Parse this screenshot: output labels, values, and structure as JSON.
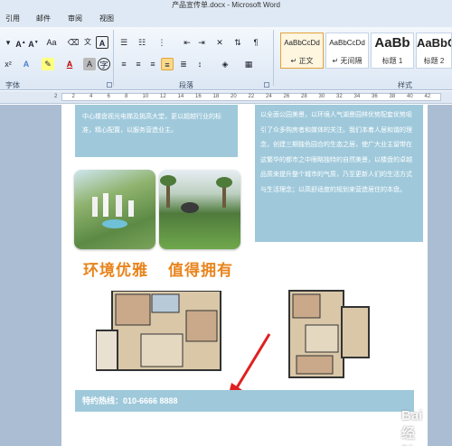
{
  "window": {
    "title": "产品宣传单.docx - Microsoft Word"
  },
  "tabs": [
    "引用",
    "邮件",
    "审阅",
    "视图"
  ],
  "groups": {
    "font": "字体",
    "paragraph": "段落",
    "styles": "样式"
  },
  "styles": [
    {
      "sample": "AaBbCcDd",
      "name": "↵ 正文"
    },
    {
      "sample": "AaBbCcDd",
      "name": "↵ 无间隔"
    },
    {
      "sample": "AaBb",
      "name": "标题 1"
    },
    {
      "sample": "AaBbC",
      "name": "标题 2"
    }
  ],
  "ruler_labels": [
    "2",
    "2",
    "4",
    "6",
    "8",
    "10",
    "12",
    "14",
    "16",
    "18",
    "20",
    "22",
    "24",
    "26",
    "28",
    "30",
    "32",
    "34",
    "36",
    "38",
    "40",
    "42"
  ],
  "document": {
    "left_box_text": "中心楼盘视光电梯及挑高大堂，更以超越行业的标准，精心配置，以服务营造业主。",
    "right_box_text": "以全面公园美景，以环境人气湖景园林优势配套优势吸引了众多购房者和媒体的关注。我们本着人居和谐的理念，创建三期独色园合的生态之居，使广大业主留带在这繁华的都市之中眼略独特的自然美景，以楼盘的卓越品质来提升整个城市的气质，乃至更新人们的生活方式与生活理念；以高舒适度的规划来营造居住的本盘。",
    "headline_left": "环境优雅",
    "headline_right": "值得拥有",
    "hotline": "特约热线：010-6666 8888",
    "watermark": "Bai 经验"
  },
  "colors": {
    "accent_box": "#9fc9db",
    "headline": "#e8841d",
    "arrow": "#e02020"
  }
}
